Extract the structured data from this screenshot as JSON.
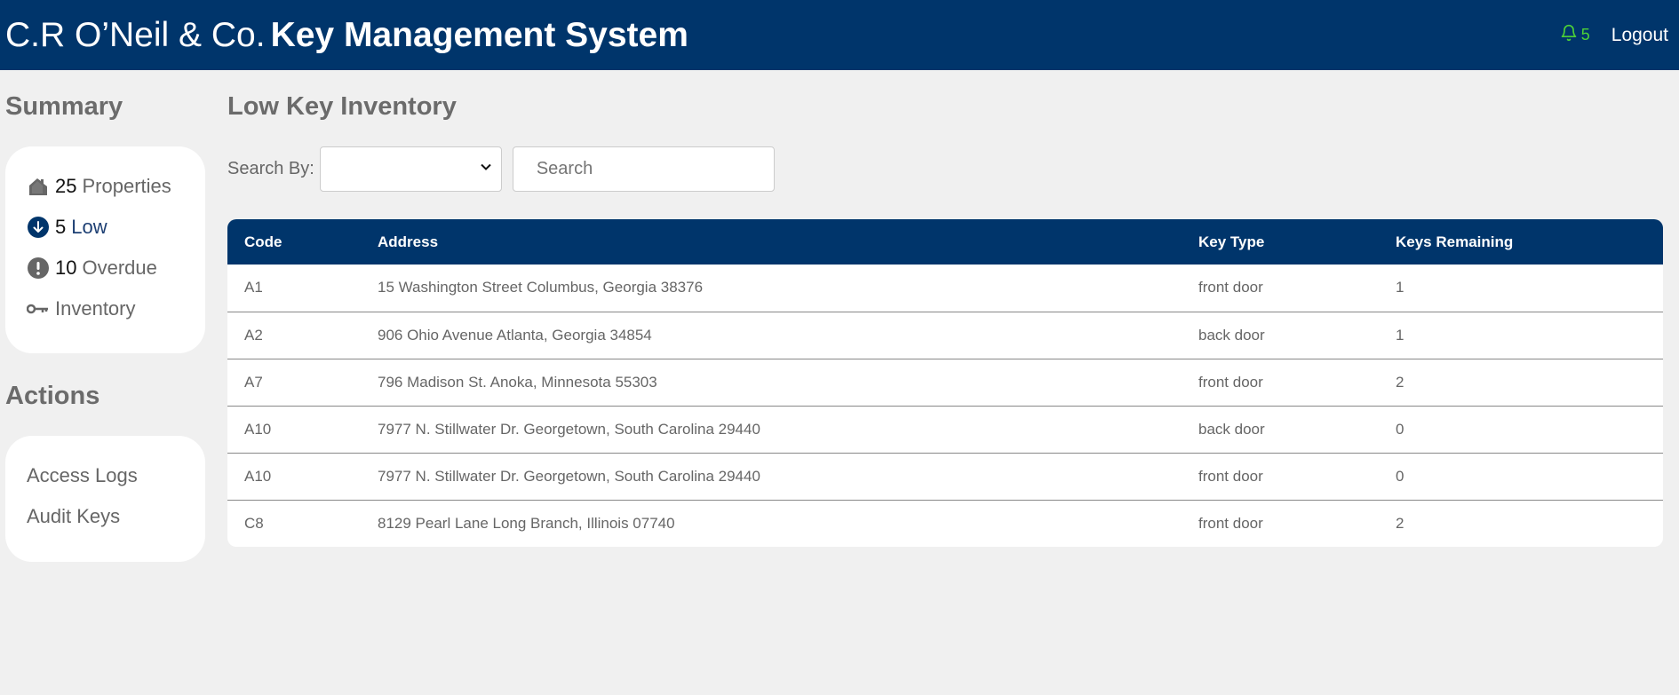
{
  "header": {
    "company": "C.R O’Neil & Co.",
    "system": "Key Management System",
    "notification_count": "5",
    "logout_label": "Logout"
  },
  "colors": {
    "header_bg": "#00356b",
    "notification": "#4cd137",
    "background": "#f0f0f0"
  },
  "sidebar": {
    "summary_heading": "Summary",
    "summary_items": [
      {
        "icon": "house-icon",
        "count": "25",
        "label": "Properties"
      },
      {
        "icon": "arrow-down-circle-icon",
        "count": "5",
        "label": "Low"
      },
      {
        "icon": "exclamation-circle-icon",
        "count": "10",
        "label": "Overdue"
      },
      {
        "icon": "key-icon",
        "count": "",
        "label": "Inventory"
      }
    ],
    "actions_heading": "Actions",
    "actions": [
      {
        "label": "Access Logs"
      },
      {
        "label": "Audit Keys"
      }
    ]
  },
  "main": {
    "title": "Low Key Inventory",
    "search_by_label": "Search By:",
    "search_by_selected": "",
    "search_placeholder": "Search",
    "table": {
      "headers": [
        "Code",
        "Address",
        "Key Type",
        "Keys Remaining"
      ],
      "rows": [
        [
          "A1",
          "15 Washington Street Columbus, Georgia 38376",
          "front door",
          "1"
        ],
        [
          "A2",
          "906 Ohio Avenue Atlanta, Georgia 34854",
          "back door",
          "1"
        ],
        [
          "A7",
          "796 Madison St. Anoka, Minnesota 55303",
          "front door",
          "2"
        ],
        [
          "A10",
          "7977 N. Stillwater Dr. Georgetown, South Carolina 29440",
          "back door",
          "0"
        ],
        [
          "A10",
          "7977 N. Stillwater Dr. Georgetown, South Carolina 29440",
          "front door",
          "0"
        ],
        [
          "C8",
          "8129 Pearl Lane Long Branch, Illinois 07740",
          "front door",
          "2"
        ]
      ]
    }
  }
}
